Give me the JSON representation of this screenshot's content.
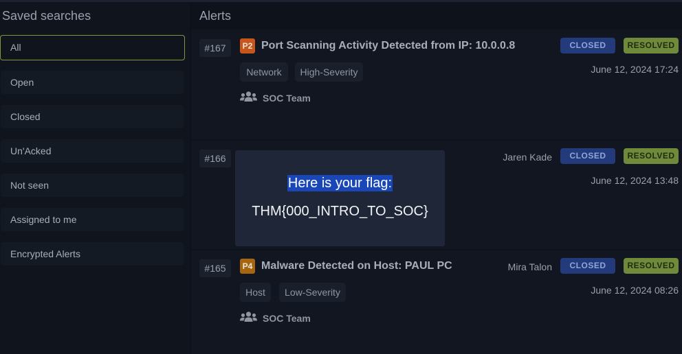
{
  "sidebar": {
    "title": "Saved searches",
    "items": [
      {
        "label": "All"
      },
      {
        "label": "Open"
      },
      {
        "label": "Closed"
      },
      {
        "label": "Un'Acked"
      },
      {
        "label": "Not seen"
      },
      {
        "label": "Assigned to me"
      },
      {
        "label": "Encrypted Alerts"
      }
    ]
  },
  "main": {
    "title": "Alerts",
    "alerts": [
      {
        "id": "#167",
        "priority": "P2",
        "title": "Port Scanning Activity Detected from IP: 10.0.0.8",
        "assignee": "",
        "status": "CLOSED",
        "resolution": "RESOLVED",
        "date": "June 12, 2024 17:24",
        "tags": [
          "Network",
          "High-Severity"
        ],
        "team": "SOC Team"
      },
      {
        "id": "#166",
        "priority": "",
        "title": "",
        "assignee": "Jaren Kade",
        "status": "CLOSED",
        "resolution": "RESOLVED",
        "date": "June 12, 2024 13:48",
        "tags": [],
        "team": ""
      },
      {
        "id": "#165",
        "priority": "P4",
        "title": "Malware Detected on Host: PAUL PC",
        "assignee": "Mira Talon",
        "status": "CLOSED",
        "resolution": "RESOLVED",
        "date": "June 12, 2024 08:26",
        "tags": [
          "Host",
          "Low-Severity"
        ],
        "team": "SOC Team"
      }
    ]
  },
  "modal": {
    "heading": "Here is your flag:",
    "flag": "THM{000_INTRO_TO_SOC}"
  },
  "colors": {
    "p2": "#c8561a",
    "p4": "#a8650f",
    "closed_badge": "#233b7a",
    "resolved_badge": "#6e8a3a",
    "active_border": "#7f9a3a"
  },
  "icons": {
    "team": "users-icon"
  }
}
